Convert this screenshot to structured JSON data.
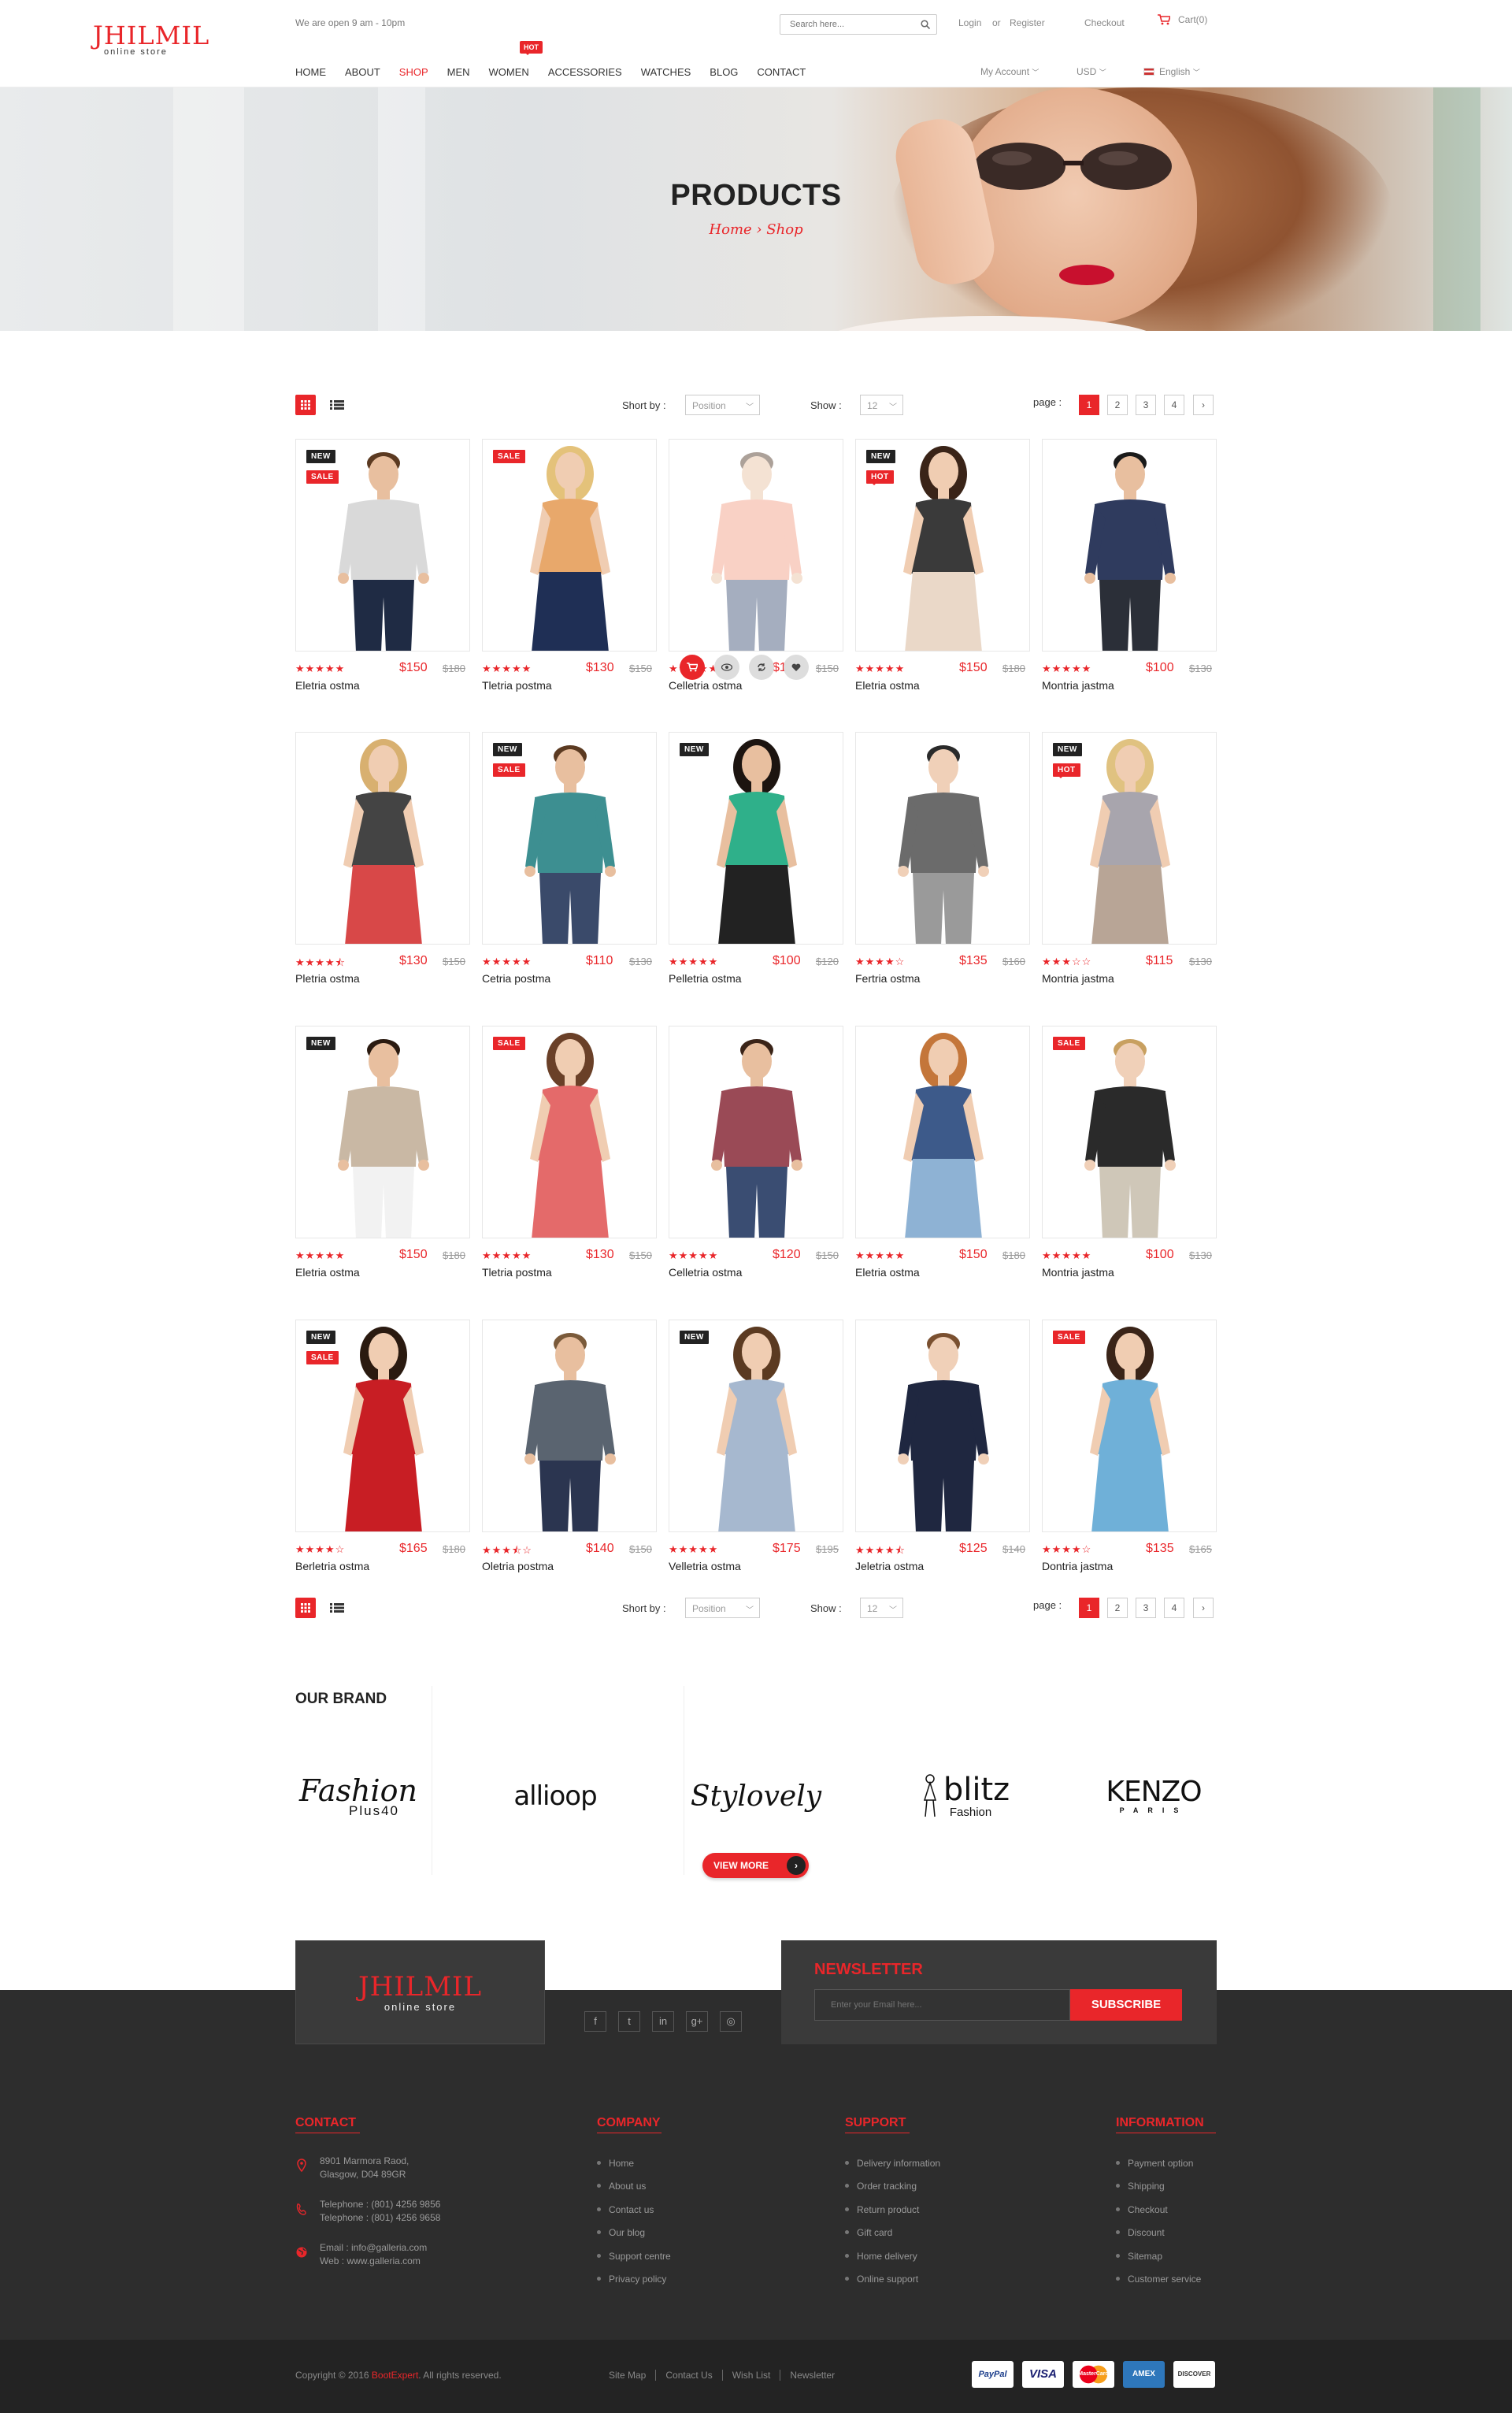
{
  "header": {
    "logo_main": "JHILMIL",
    "logo_sub": "online store",
    "open_hours": "We are open 9 am - 10pm",
    "search_placeholder": "Search here...",
    "login": "Login",
    "or": "or",
    "register": "Register",
    "checkout": "Checkout",
    "cart": "Cart(0)",
    "nav": [
      "HOME",
      "ABOUT",
      "SHOP",
      "MEN",
      "WOMEN",
      "ACCESSORIES",
      "WATCHES",
      "BLOG",
      "CONTACT"
    ],
    "active_nav": "SHOP",
    "hot_label": "HOT",
    "my_account": "My Account",
    "currency": "USD",
    "language": "English"
  },
  "banner": {
    "title": "PRODUCTS",
    "breadcrumb": "Home › Shop"
  },
  "toolbar": {
    "sort_label": "Short by :",
    "sort_value": "Position",
    "show_label": "Show :",
    "show_value": "12",
    "page_label": "page :",
    "pages": [
      "1",
      "2",
      "3",
      "4"
    ],
    "next": "›"
  },
  "products": [
    {
      "name": "Eletria ostma",
      "price": "$150",
      "old": "$180",
      "rating": 5,
      "badges": [
        "NEW",
        "SALE"
      ],
      "figure": "man",
      "top": "#d9d9d9",
      "bottom": "#1f2b44",
      "skin": "#e8bf9f",
      "hair": "#5b3a21"
    },
    {
      "name": "Tletria postma",
      "price": "$130",
      "old": "$150",
      "rating": 5,
      "badges": [
        "SALE"
      ],
      "figure": "woman",
      "top": "#e8a86b",
      "bottom": "#1f2f55",
      "skin": "#f0cdb2",
      "hair": "#e4c27a"
    },
    {
      "name": "Celletria ostma",
      "price": "$120",
      "old": "$150",
      "rating": 5,
      "badges": [],
      "figure": "man",
      "top": "#f29a80",
      "bottom": "#3a4d72",
      "skin": "#e8bf9f",
      "hair": "#4a3020",
      "hover": true
    },
    {
      "name": "Eletria ostma",
      "price": "$150",
      "old": "$180",
      "rating": 5,
      "badges": [
        "NEW",
        "HOT"
      ],
      "figure": "woman",
      "top": "#3a3a3a",
      "bottom": "#ead8c8",
      "skin": "#f0cdb2",
      "hair": "#3a2418"
    },
    {
      "name": "Montria jastma",
      "price": "$100",
      "old": "$130",
      "rating": 5,
      "badges": [],
      "figure": "man",
      "top": "#2f3b5e",
      "bottom": "#2b2f38",
      "skin": "#e8bf9f",
      "hair": "#1a1a1a"
    },
    {
      "name": "Pletria ostma",
      "price": "$130",
      "old": "$150",
      "rating": 4.5,
      "badges": [],
      "figure": "woman",
      "top": "#444",
      "bottom": "#d84848",
      "skin": "#f0cdb2",
      "hair": "#d8b070"
    },
    {
      "name": "Cetria postma",
      "price": "$110",
      "old": "$130",
      "rating": 5,
      "badges": [
        "NEW",
        "SALE"
      ],
      "figure": "man",
      "top": "#3d8f91",
      "bottom": "#3a4a6a",
      "skin": "#e8bf9f",
      "hair": "#5b3a21"
    },
    {
      "name": "Pelletria ostma",
      "price": "$100",
      "old": "$120",
      "rating": 5,
      "badges": [
        "NEW"
      ],
      "figure": "woman",
      "top": "#2fb08a",
      "bottom": "#222",
      "skin": "#e8bf9f",
      "hair": "#1c1410"
    },
    {
      "name": "Fertria ostma",
      "price": "$135",
      "old": "$160",
      "rating": 4,
      "badges": [],
      "figure": "man",
      "top": "#6b6b6b",
      "bottom": "#9a9a9a",
      "skin": "#f0d0b8",
      "hair": "#2a2a2a"
    },
    {
      "name": "Montria jastma",
      "price": "$115",
      "old": "$130",
      "rating": 3,
      "badges": [
        "NEW",
        "HOT"
      ],
      "figure": "woman",
      "top": "#a8a5ad",
      "bottom": "#b8a596",
      "skin": "#f0cdb2",
      "hair": "#e0c280"
    },
    {
      "name": "Eletria ostma",
      "price": "$150",
      "old": "$180",
      "rating": 5,
      "badges": [
        "NEW"
      ],
      "figure": "man",
      "top": "#c9b8a4",
      "bottom": "#f2f2f2",
      "skin": "#e8bf9f",
      "hair": "#2a1a10"
    },
    {
      "name": "Tletria postma",
      "price": "$130",
      "old": "$150",
      "rating": 5,
      "badges": [
        "SALE"
      ],
      "figure": "woman",
      "top": "#e46a6a",
      "bottom": "#e46a6a",
      "skin": "#f0cdb2",
      "hair": "#6a4028"
    },
    {
      "name": "Celletria ostma",
      "price": "$120",
      "old": "$150",
      "rating": 5,
      "badges": [],
      "figure": "man",
      "top": "#9a4a56",
      "bottom": "#3a4d72",
      "skin": "#e8bf9f",
      "hair": "#3a2418"
    },
    {
      "name": "Eletria ostma",
      "price": "$150",
      "old": "$180",
      "rating": 5,
      "badges": [],
      "figure": "woman",
      "top": "#3d5a8a",
      "bottom": "#8eb2d4",
      "skin": "#f0cdb2",
      "hair": "#c4763a"
    },
    {
      "name": "Montria jastma",
      "price": "$100",
      "old": "$130",
      "rating": 5,
      "badges": [
        "SALE"
      ],
      "figure": "man",
      "top": "#2a2a2a",
      "bottom": "#cfc7b8",
      "skin": "#f0d0b8",
      "hair": "#c8a060"
    },
    {
      "name": "Berletria ostma",
      "price": "$165",
      "old": "$180",
      "rating": 4,
      "badges": [
        "NEW",
        "SALE"
      ],
      "figure": "woman",
      "top": "#c81e24",
      "bottom": "#c81e24",
      "skin": "#f0cdb2",
      "hair": "#2a1a10"
    },
    {
      "name": "Oletria postma",
      "price": "$140",
      "old": "$150",
      "rating": 3.5,
      "badges": [],
      "figure": "man",
      "top": "#5a6470",
      "bottom": "#2b3550",
      "skin": "#e8bf9f",
      "hair": "#7a5a3a"
    },
    {
      "name": "Velletria ostma",
      "price": "$175",
      "old": "$195",
      "rating": 5,
      "badges": [
        "NEW"
      ],
      "figure": "woman",
      "top": "#a6b8cf",
      "bottom": "#a6b8cf",
      "skin": "#f0cdb2",
      "hair": "#5b3a21"
    },
    {
      "name": "Jeletria ostma",
      "price": "$125",
      "old": "$140",
      "rating": 4.5,
      "badges": [],
      "figure": "man",
      "top": "#1f2740",
      "bottom": "#1f2740",
      "skin": "#f0d0b8",
      "hair": "#7a5030"
    },
    {
      "name": "Dontria jastma",
      "price": "$135",
      "old": "$165",
      "rating": 4,
      "badges": [
        "SALE"
      ],
      "figure": "woman",
      "top": "#6fb0d8",
      "bottom": "#6fb0d8",
      "skin": "#f0cdb2",
      "hair": "#3a2418"
    }
  ],
  "brands": {
    "title": "OUR BRAND",
    "items": [
      {
        "name": "Fashion",
        "sub": "Plus40"
      },
      {
        "name": "allioop",
        "sub": ""
      },
      {
        "name": "Stylovely",
        "sub": ""
      },
      {
        "name": "blitz",
        "sub": "Fashion"
      },
      {
        "name": "KENZO",
        "sub": "PARIS"
      }
    ],
    "view_more": "VIEW MORE"
  },
  "footer": {
    "logo_main": "JHILMIL",
    "logo_sub": "online store",
    "socials": [
      "f",
      "t",
      "in",
      "g+",
      "◎"
    ],
    "newsletter_title": "NEWSLETTER",
    "newsletter_placeholder": "Enter your Email here...",
    "subscribe": "SUBSCRIBE",
    "contact_title": "CONTACT",
    "address1": "8901 Marmora Raod,",
    "address2": "Glasgow, D04  89GR",
    "phone1": "Telephone : (801) 4256  9856",
    "phone2": "Telephone : (801) 4256  9658",
    "email": "Email : info@galleria.com",
    "web": "Web : www.galleria.com",
    "company_title": "COMPANY",
    "company": [
      "Home",
      "About us",
      "Contact us",
      "Our blog",
      "Support centre",
      "Privacy policy"
    ],
    "support_title": "SUPPORT",
    "support": [
      "Delivery information",
      "Order tracking",
      "Return product",
      "Gift card",
      "Home delivery",
      "Online support"
    ],
    "information_title": "INFORMATION",
    "information": [
      "Payment option",
      "Shipping",
      "Checkout",
      "Discount",
      "Sitemap",
      "Customer service"
    ],
    "copyright_pre": "Copyright © 2016",
    "copyright_brand": "BootExpert",
    "copyright_post": ". All rights reserved.",
    "bottom_links": [
      "Site Map",
      "Contact Us",
      "Wish List",
      "Newsletter"
    ],
    "payments": [
      "PayPal",
      "VISA",
      "MasterCard",
      "AMEX",
      "DISCOVER"
    ]
  },
  "colors": {
    "accent": "#e9262a",
    "footer": "#2d2d2d"
  }
}
